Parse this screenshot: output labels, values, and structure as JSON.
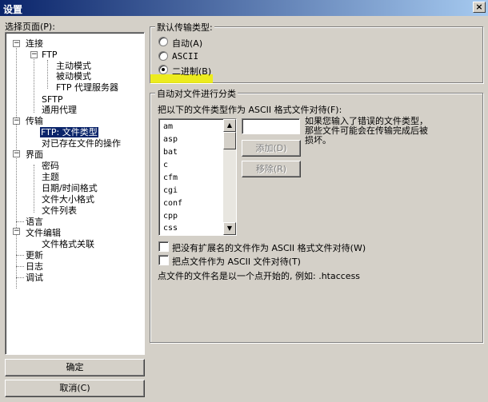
{
  "window": {
    "title": "设置",
    "close_glyph": "×"
  },
  "left": {
    "select_label": "选择页面(P):",
    "tree": [
      "连接",
      "FTP",
      "主动模式",
      "被动模式",
      "FTP 代理服务器",
      "SFTP",
      "通用代理",
      "传输",
      "FTP: 文件类型",
      "对已存在文件的操作",
      "界面",
      "密码",
      "主题",
      "日期/时间格式",
      "文件大小格式",
      "文件列表",
      "语言",
      "文件编辑",
      "文件格式关联",
      "更新",
      "日志",
      "调试"
    ],
    "expander_glyph": "−",
    "ok": "确定",
    "cancel": "取消(C)"
  },
  "right": {
    "default_group": "默认传输类型:",
    "radio_auto": "自动(A)",
    "radio_ascii": "ASCII",
    "radio_binary": "二进制(B)",
    "auto_group": "自动对文件进行分类",
    "treat_label": "把以下的文件类型作为 ASCII 格式文件对待(F):",
    "extensions": [
      "am",
      "asp",
      "bat",
      "c",
      "cfm",
      "cgi",
      "conf",
      "cpp",
      "css"
    ],
    "hint": "如果您输入了错误的文件类型，那些文件可能会在传输完成后被损坏。",
    "add": "添加(D)",
    "remove": "移除(R)",
    "check_noext": "把没有扩展名的文件作为 ASCII 格式文件对待(W)",
    "check_dot": "把点文件作为 ASCII 文件对待(T)",
    "dot_note": "点文件的文件名是以一个点开始的, 例如: .htaccess",
    "scroll_up": "▲",
    "scroll_down": "▼"
  }
}
